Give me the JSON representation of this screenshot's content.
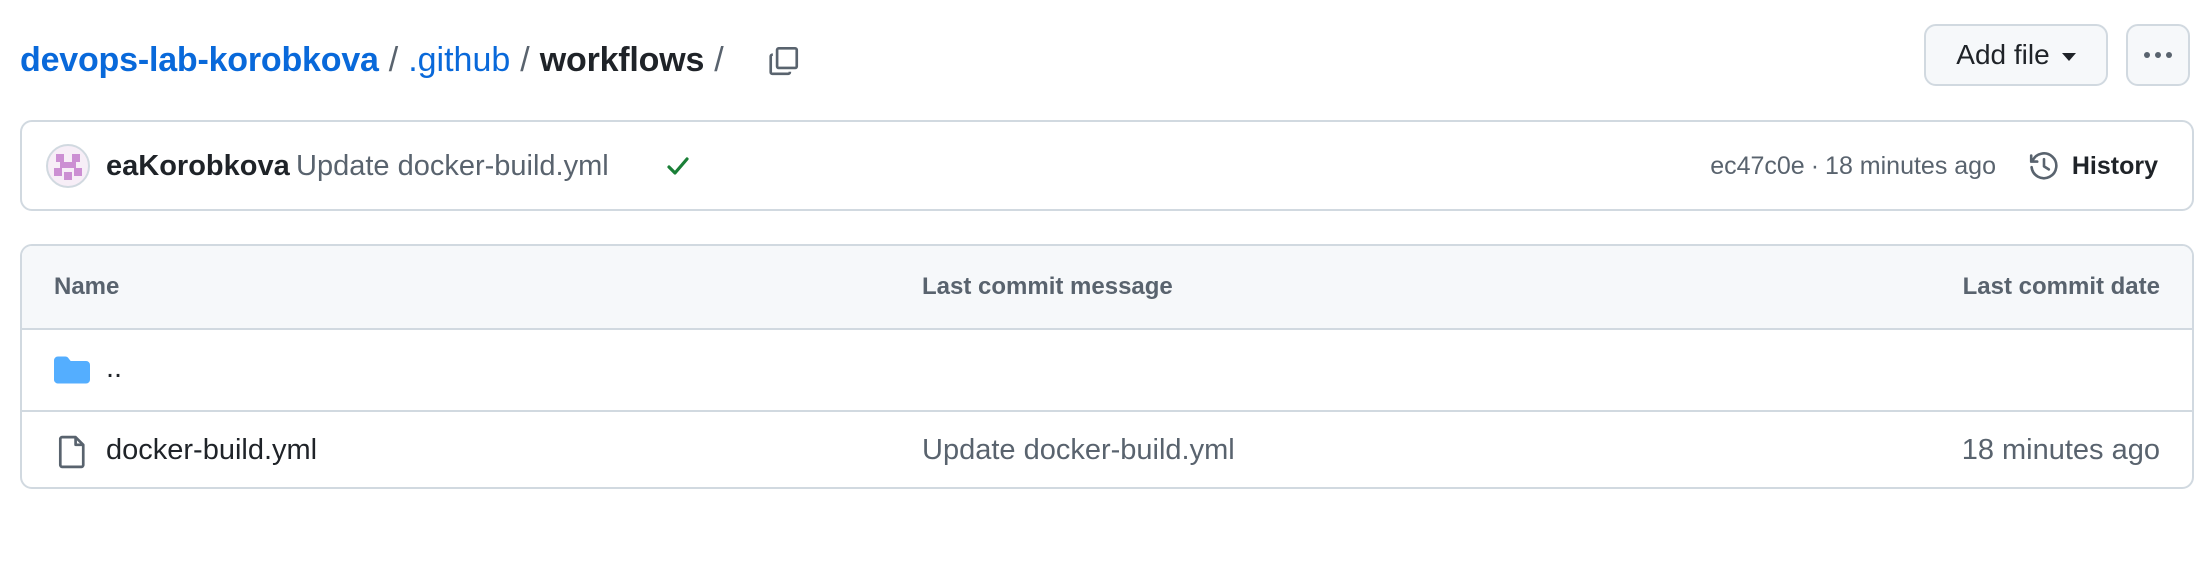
{
  "breadcrumb": {
    "repo": "devops-lab-korobkova",
    "folder": ".github",
    "current": "workflows",
    "separator": "/"
  },
  "toolbar": {
    "add_file_label": "Add file",
    "more_icon": "kebab-horizontal-icon",
    "copy_icon": "copy-icon"
  },
  "latest_commit": {
    "author": "eaKorobkova",
    "message": "Update docker-build.yml",
    "status_icon": "check-icon",
    "status_color": "#1a7f37",
    "hash": "ec47c0e",
    "separator": "·",
    "time": "18 minutes ago",
    "history_label": "History"
  },
  "file_table": {
    "headers": {
      "name": "Name",
      "message": "Last commit message",
      "date": "Last commit date"
    },
    "rows": [
      {
        "icon": "folder-icon",
        "name": "..",
        "message": "",
        "date": ""
      },
      {
        "icon": "file-icon",
        "name": "docker-build.yml",
        "message": "Update docker-build.yml",
        "date": "18 minutes ago"
      }
    ]
  },
  "colors": {
    "link": "#0969da",
    "muted": "#59636e",
    "border": "#d1d9e0",
    "folder": "#54aeff"
  }
}
